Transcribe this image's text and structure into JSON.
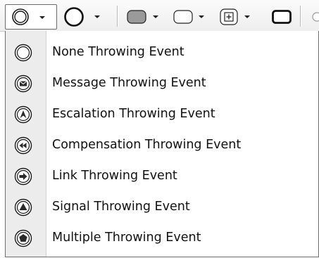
{
  "toolbar": {
    "buttons": [
      {
        "icon": "event-throwing-icon",
        "has_dropdown": true,
        "pressed": true
      },
      {
        "icon": "circle-icon",
        "has_dropdown": true
      },
      {
        "icon": "rounded-rect-filled-icon",
        "has_dropdown": true
      },
      {
        "icon": "rounded-rect-icon",
        "has_dropdown": true
      },
      {
        "icon": "subprocess-icon",
        "has_dropdown": true
      },
      {
        "icon": "rect-bold-icon",
        "has_dropdown": false
      }
    ]
  },
  "menu": {
    "items": [
      {
        "label": "None Throwing Event",
        "icon": "none-throwing-event-icon"
      },
      {
        "label": "Message Throwing Event",
        "icon": "message-throwing-event-icon"
      },
      {
        "label": "Escalation Throwing Event",
        "icon": "escalation-throwing-event-icon"
      },
      {
        "label": "Compensation Throwing Event",
        "icon": "compensation-throwing-event-icon"
      },
      {
        "label": "Link Throwing Event",
        "icon": "link-throwing-event-icon"
      },
      {
        "label": "Signal Throwing Event",
        "icon": "signal-throwing-event-icon"
      },
      {
        "label": "Multiple Throwing Event",
        "icon": "multiple-throwing-event-icon"
      }
    ]
  },
  "colors": {
    "icon_stroke": "#1a1a1a",
    "icon_fill_dark": "#2a2a2a",
    "toolbar_bg": "#f2f2f2",
    "gutter_bg": "#ececec"
  }
}
